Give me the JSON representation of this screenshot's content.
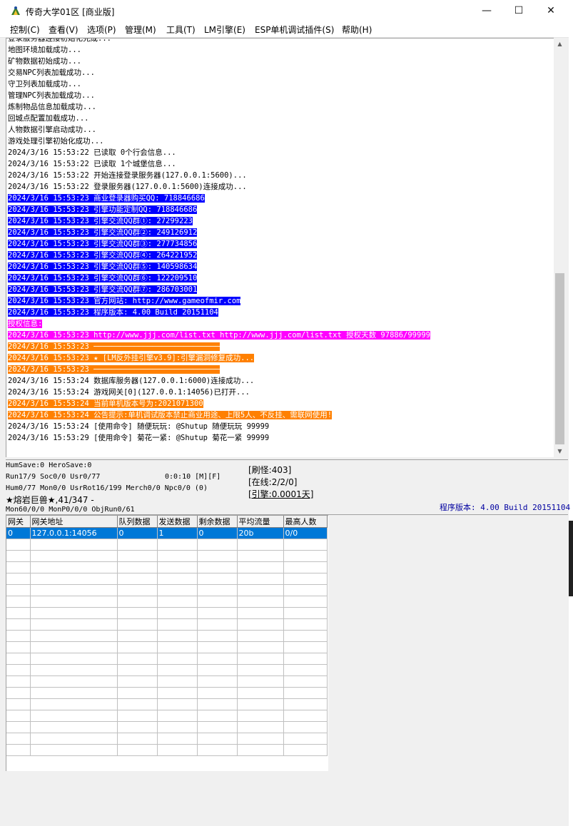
{
  "window": {
    "title": "传奇大学01区 [商业版]",
    "minimize": "—",
    "maximize": "☐",
    "close": "✕"
  },
  "menu": [
    "控制(C)",
    "查看(V)",
    "选项(P)",
    "管理(M)",
    "工具(T)",
    "LM引擎(E)",
    "ESP单机调试插件(S)",
    "帮助(H)"
  ],
  "log": [
    {
      "text": "登录服务器连接初始化完成...",
      "style": ""
    },
    {
      "text": "地图环境加载成功...",
      "style": ""
    },
    {
      "text": "矿物数据初始成功...",
      "style": ""
    },
    {
      "text": "交易NPC列表加载成功...",
      "style": ""
    },
    {
      "text": "守卫列表加载成功...",
      "style": ""
    },
    {
      "text": "管理NPC列表加载成功...",
      "style": ""
    },
    {
      "text": "炼制物品信息加载成功...",
      "style": ""
    },
    {
      "text": "回城点配置加载成功...",
      "style": ""
    },
    {
      "text": "人物数据引擎启动成功...",
      "style": ""
    },
    {
      "text": "游戏处理引擎初始化成功...",
      "style": ""
    },
    {
      "text": "2024/3/16 15:53:22 已读取 0个行会信息...",
      "style": ""
    },
    {
      "text": "2024/3/16 15:53:22 已读取 1个城堡信息...",
      "style": ""
    },
    {
      "text": "2024/3/16 15:53:22 开始连接登录服务器(127.0.0.1:5600)...",
      "style": ""
    },
    {
      "text": "2024/3/16 15:53:22 登录服务器(127.0.0.1:5600)连接成功...",
      "style": ""
    },
    {
      "text": "2024/3/16 15:53:23 商业登录器购买QQ: 718846686",
      "style": "blue"
    },
    {
      "text": "2024/3/16 15:53:23 引擎功能定制QQ: 718846686",
      "style": "blue"
    },
    {
      "text": "2024/3/16 15:53:23 引擎交流QQ群①: 27299223",
      "style": "blue"
    },
    {
      "text": "2024/3/16 15:53:23 引擎交流QQ群②: 249126912",
      "style": "blue"
    },
    {
      "text": "2024/3/16 15:53:23 引擎交流QQ群③: 277734856",
      "style": "blue"
    },
    {
      "text": "2024/3/16 15:53:23 引擎交流QQ群④: 264221952",
      "style": "blue"
    },
    {
      "text": "2024/3/16 15:53:23 引擎交流QQ群⑤: 140598634",
      "style": "blue"
    },
    {
      "text": "2024/3/16 15:53:23 引擎交流QQ群⑥: 122209510",
      "style": "blue"
    },
    {
      "text": "2024/3/16 15:53:23 引擎交流QQ群⑦: 286703001",
      "style": "blue"
    },
    {
      "text": "2024/3/16 15:53:23 官方网站: http://www.gameofmir.com",
      "style": "blue"
    },
    {
      "text": "2024/3/16 15:53:23 程序版本: 4.00 Build 20151104",
      "style": "blue"
    },
    {
      "text": "授权信息:",
      "style": "magenta"
    },
    {
      "text": "2024/3/16 15:53:23 http://www.jjj.com/list.txt http://www.jjj.com/list.txt 授权天数 97886/99999",
      "style": "magenta"
    },
    {
      "text": "2024/3/16 15:53:23 ────────────────────────────",
      "style": "orange"
    },
    {
      "text": "2024/3/16 15:53:23 ★ [LM反外挂引擎v3.9]:引擎漏洞修复成功...",
      "style": "orange"
    },
    {
      "text": "2024/3/16 15:53:23 ────────────────────────────",
      "style": "orange"
    },
    {
      "text": "2024/3/16 15:53:24 数据库服务器(127.0.0.1:6000)连接成功...",
      "style": ""
    },
    {
      "text": "2024/3/16 15:53:24 游戏网关[0](127.0.0.1:14056)已打开...",
      "style": ""
    },
    {
      "text": "2024/3/16 15:53:24 当前单机版本号为:2021071300",
      "style": "orange"
    },
    {
      "text": "2024/3/16 15:53:24 公告提示:单机调试版本禁止商业用途、上限5人、不反挂、需联网使用!",
      "style": "orange"
    },
    {
      "text": "2024/3/16 15:53:24 [使用命令] 随便玩玩: @Shutup 随便玩玩 99999",
      "style": ""
    },
    {
      "text": "2024/3/16 15:53:29 [使用命令] 菊花一紧: @Shutup 菊花一紧 99999",
      "style": ""
    }
  ],
  "status": {
    "line1": "HumSave:0 HeroSave:0",
    "line2": "Run17/9 Soc0/0 Usr0/77",
    "line2b": "0:0:10 [M][F]",
    "line3": "Hum0/77 Mon0/0 UsrRot16/199 Merch0/0 Npc0/0 (0)",
    "line4": "★熔岩巨兽★,41/347 -",
    "line5": "Mon60/0/0 MonP0/0/0 ObjRun0/61",
    "refresh": "[刷怪:403]",
    "online": "[在线:2/2/0]",
    "engine": "[引擎:0.0001天]",
    "version": "程序版本: 4.00 Build 20151104"
  },
  "grid": {
    "headers": [
      "网关",
      "网关地址",
      "队列数据",
      "发送数据",
      "剩余数据",
      "平均流量",
      "最高人数"
    ],
    "rows": [
      [
        "0",
        "127.0.0.1:14056",
        "0",
        "1",
        "0",
        "20b",
        "0/0"
      ]
    ],
    "empty_rows": 19
  },
  "colors": {
    "highlight_blue": "#0000ff",
    "highlight_magenta": "#ff00ff",
    "highlight_orange": "#ff8000",
    "selection": "#0078d7",
    "version_text": "#0000a0"
  }
}
